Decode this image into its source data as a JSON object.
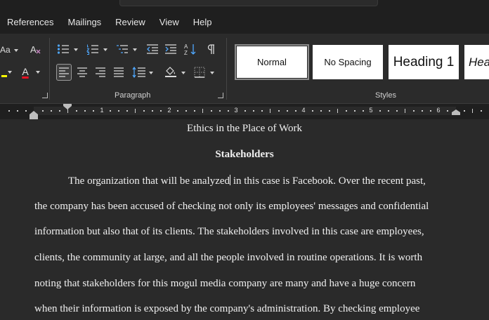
{
  "menu": {
    "tabs": [
      "References",
      "Mailings",
      "Review",
      "View",
      "Help"
    ]
  },
  "ribbon": {
    "font_size_label": "Aa",
    "paragraph_group_label": "Paragraph",
    "styles_group_label": "Styles",
    "styles": [
      {
        "label": "Normal",
        "selected": true
      },
      {
        "label": "No Spacing",
        "selected": false
      },
      {
        "label": "Heading 1",
        "selected": false
      },
      {
        "label": "Hea",
        "selected": false
      }
    ],
    "font_color_letter": "A",
    "font_color": "#e81123",
    "highlight_color": "#ffff00"
  },
  "ruler": {
    "numbers": [
      "1",
      "2",
      "3",
      "4",
      "5",
      "6"
    ]
  },
  "document": {
    "title": "Ethics in the Place of Work",
    "heading": "Stakeholders",
    "lines": [
      "The organization that will be analyzed",
      "in this case is Facebook. Over the recent past,",
      "the company has been accused of checking not only its employees' messages and confidential",
      "information but also that of its clients. The stakeholders involved in this case are employees,",
      "clients, the community at large, and all the people involved in routine operations. It is worth",
      "noting that stakeholders for this mogul media company are many and have a huge concern",
      "when their information is exposed by the company's administration. By checking employee"
    ]
  }
}
